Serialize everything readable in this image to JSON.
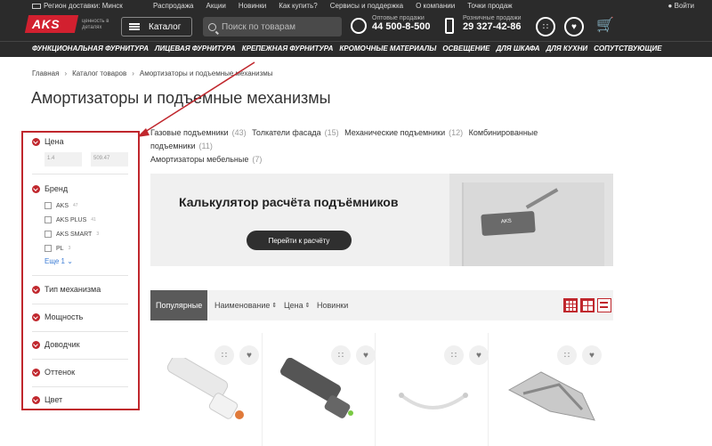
{
  "topbar": {
    "delivery": "Регион доставки: Минск",
    "links": [
      "Распродажа",
      "Акции",
      "Новинки",
      "Как купить?",
      "Сервисы и поддержка",
      "О компании",
      "Точки продаж"
    ],
    "login": "Войти"
  },
  "header": {
    "logo": "AKS",
    "tagline": "ценность в деталях",
    "catalog_label": "Каталог",
    "search_placeholder": "Поиск по товарам",
    "wholesale_label": "Оптовые продажи",
    "wholesale_phone": "44 500-8-500",
    "retail_label": "Розничные продажи",
    "retail_phone": "29 327-42-86"
  },
  "nav": {
    "items": [
      "Функциональная фурнитура",
      "Лицевая фурнитура",
      "Крепежная фурнитура",
      "Кромочные материалы",
      "Освещение",
      "Для шкафа",
      "Для кухни",
      "Сопутствующие"
    ]
  },
  "breadcrumb": [
    "Главная",
    "Каталог товаров",
    "Амортизаторы и подъемные механизмы"
  ],
  "page_title": "Амортизаторы и подъемные механизмы",
  "filters": {
    "price_label": "Цена",
    "price_min": "1.4",
    "price_max": "509.47",
    "brand_label": "Бренд",
    "brands": [
      {
        "name": "AKS",
        "count": "47"
      },
      {
        "name": "AKS PLUS",
        "count": "41"
      },
      {
        "name": "AKS SMART",
        "count": "3"
      },
      {
        "name": "PL",
        "count": "3"
      }
    ],
    "more_label": "Еще 1",
    "sections": [
      "Тип механизма",
      "Мощность",
      "Доводчик",
      "Оттенок",
      "Цвет"
    ]
  },
  "categories": [
    {
      "name": "Газовые подъемники",
      "count": "(43)"
    },
    {
      "name": "Толкатели фасада",
      "count": "(15)"
    },
    {
      "name": "Механические подъемники",
      "count": "(12)"
    },
    {
      "name": "Комбинированные подъемники",
      "count": "(11)"
    },
    {
      "name": "Амортизаторы мебельные",
      "count": "(7)"
    }
  ],
  "banner": {
    "title": "Калькулятор расчёта подъёмников",
    "button": "Перейти к расчёту",
    "device_label": "AKS"
  },
  "sort": {
    "options": [
      "Популярные",
      "Наименование",
      "Цена",
      "Новинки"
    ],
    "active": "Популярные"
  },
  "colors": {
    "brand_red": "#c0272d",
    "header_bg": "#2b2b2b"
  }
}
